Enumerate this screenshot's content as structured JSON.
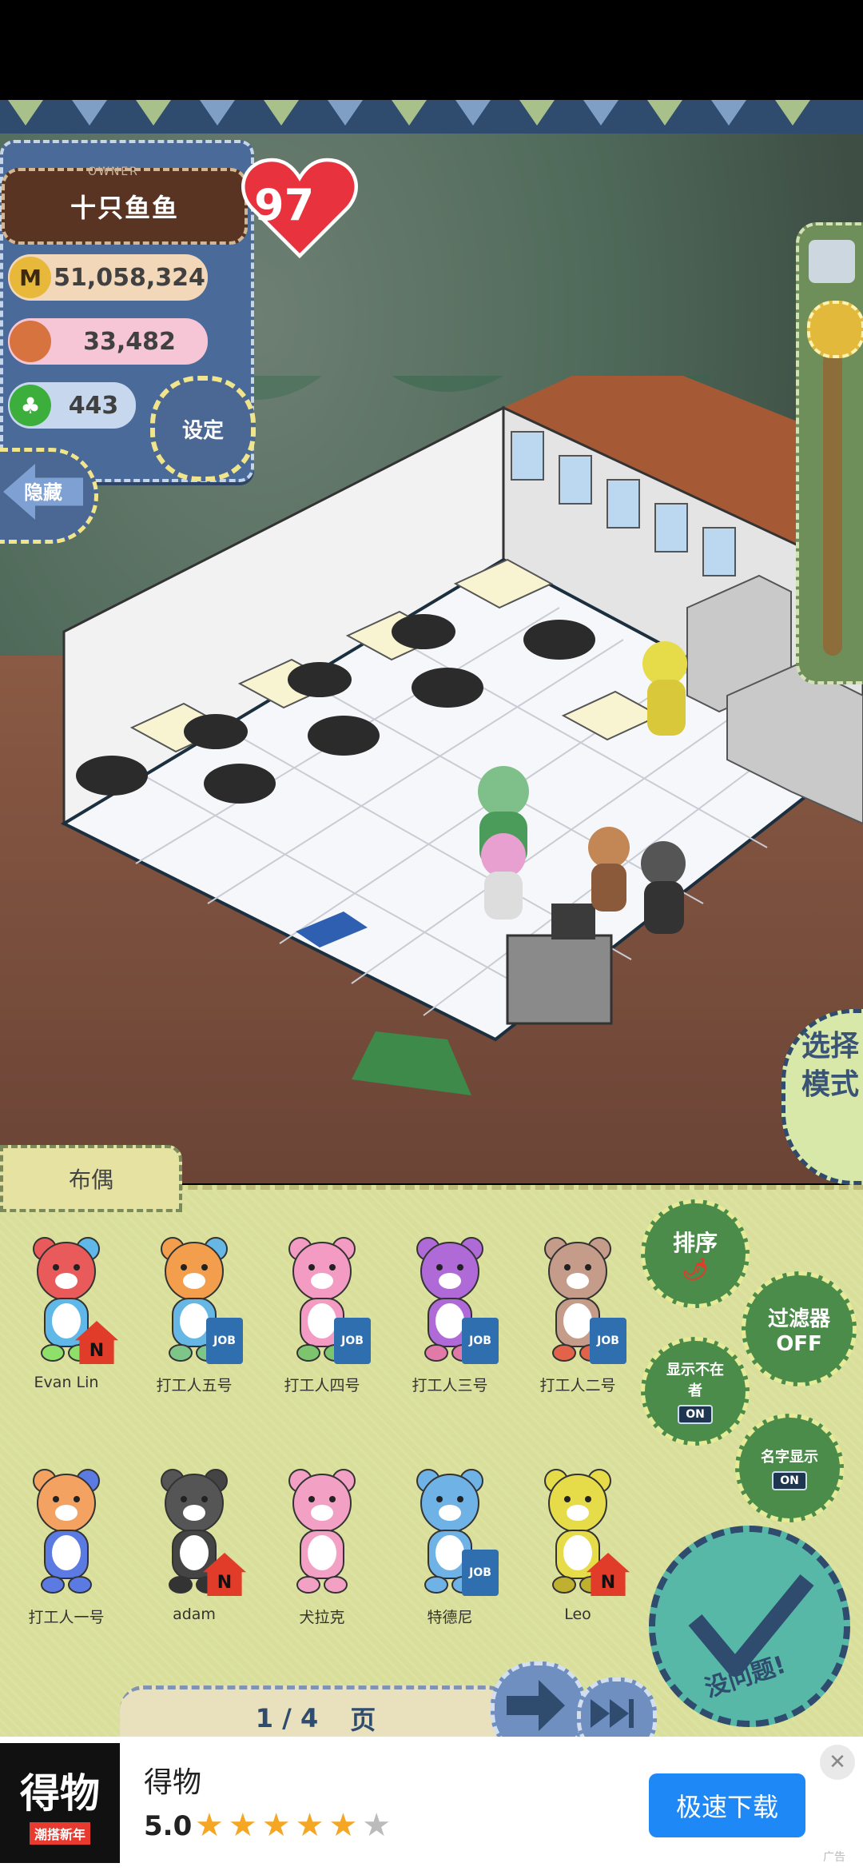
{
  "owner": {
    "label": "OWNER",
    "name": "十只鱼鱼",
    "heart_level": "97",
    "money": "51,058,324",
    "food": "33,482",
    "clover": "443",
    "coin_icon": "M"
  },
  "buttons": {
    "settings": "设定",
    "hide": "隐藏",
    "mode_select": "选择模式"
  },
  "bottom": {
    "tab_label": "布偶",
    "sort": "排序",
    "filter": "过滤器",
    "filter_state": "OFF",
    "show_absent": "显示不在者",
    "show_absent_state": "ON",
    "show_name": "名字显示",
    "show_name_state": "ON",
    "confirm": "没问题!",
    "page_current": "1 / 4",
    "page_unit": "页",
    "characters": [
      {
        "name": "Evan Lin",
        "badge": "N",
        "colors": [
          "#e95b5b",
          "#5fb8e8",
          "#8ee06b"
        ]
      },
      {
        "name": "打工人五号",
        "badge": "JOB",
        "colors": [
          "#f29e4c",
          "#67b7e5",
          "#7ec58a"
        ]
      },
      {
        "name": "打工人四号",
        "badge": "JOB",
        "colors": [
          "#f39bc2",
          "#f39bc2",
          "#7cc46e"
        ]
      },
      {
        "name": "打工人三号",
        "badge": "JOB",
        "colors": [
          "#b06ad8",
          "#b06ad8",
          "#e17aa9"
        ]
      },
      {
        "name": "打工人二号",
        "badge": "JOB",
        "colors": [
          "#c59b8a",
          "#c59b8a",
          "#e2624a"
        ]
      },
      {
        "name": "打工人一号",
        "badge": "",
        "colors": [
          "#f4a261",
          "#5b7be3",
          "#5b7be3"
        ]
      },
      {
        "name": "adam",
        "badge": "N",
        "colors": [
          "#555555",
          "#444444",
          "#333333"
        ]
      },
      {
        "name": "犬拉克",
        "badge": "",
        "colors": [
          "#f2a0c4",
          "#f2a0c4",
          "#f2a0c4"
        ]
      },
      {
        "name": "特德尼",
        "badge": "JOB",
        "colors": [
          "#6fb2e6",
          "#6fb2e6",
          "#6fb2e6"
        ]
      },
      {
        "name": "Leo",
        "badge": "N",
        "colors": [
          "#e6dc4a",
          "#e6dc4a",
          "#c0b030"
        ]
      }
    ]
  },
  "ad": {
    "app_name": "得物",
    "logo_text": "得物",
    "logo_sub": "潮搭新年",
    "rating": "5.0",
    "stars_filled": "★★★★★",
    "star_empty": "★",
    "download": "极速下载",
    "close": "✕",
    "tag": "广告"
  }
}
